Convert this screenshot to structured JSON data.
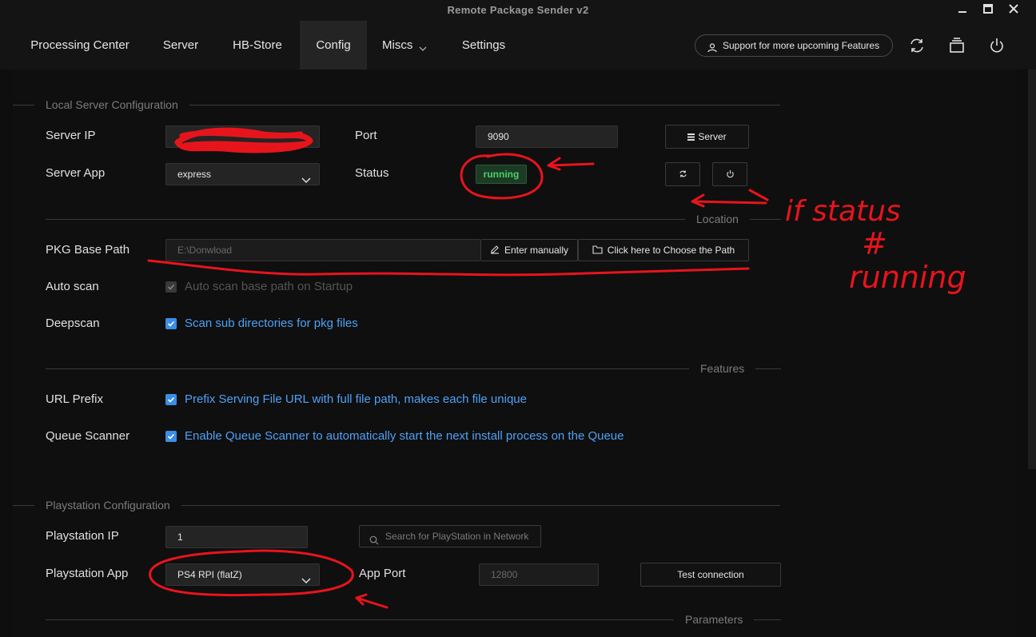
{
  "window": {
    "title": "Remote Package Sender v2"
  },
  "nav": {
    "tabs": [
      "Processing Center",
      "Server",
      "HB-Store",
      "Config",
      "Miscs",
      "Settings"
    ],
    "active": "Config",
    "support_label": "Support for more upcoming Features"
  },
  "local_server": {
    "section_title": "Local Server Configuration",
    "server_ip_label": "Server IP",
    "server_ip_value": "",
    "port_label": "Port",
    "port_value": "9090",
    "server_button": "Server",
    "server_app_label": "Server App",
    "server_app_value": "express",
    "status_label": "Status",
    "status_value": "running"
  },
  "location": {
    "section_title": "Location",
    "pkg_base_path_label": "PKG Base Path",
    "pkg_base_path_placeholder": "E:\\Donwload",
    "enter_manually_label": "Enter manually",
    "choose_path_label": "Click here to Choose the Path",
    "auto_scan_label": "Auto scan",
    "auto_scan_text": "Auto scan base path on Startup",
    "deepscan_label": "Deepscan",
    "deepscan_text": "Scan sub directories for pkg files"
  },
  "features": {
    "section_title": "Features",
    "url_prefix_label": "URL Prefix",
    "url_prefix_text": "Prefix Serving File URL with full file path, makes each file unique",
    "queue_scanner_label": "Queue Scanner",
    "queue_scanner_text": "Enable Queue Scanner to automatically start the next install process on the Queue"
  },
  "playstation": {
    "section_title": "Playstation Configuration",
    "ip_label": "Playstation IP",
    "ip_value": "1",
    "search_placeholder": "Search for PlayStation in Network",
    "app_label": "Playstation App",
    "app_value": "PS4 RPI (flatZ)",
    "app_port_label": "App Port",
    "app_port_value": "12800",
    "test_button": "Test connection"
  },
  "parameters": {
    "section_title": "Parameters"
  },
  "annotation": {
    "line1": "if status",
    "line2": "#",
    "line3": "running",
    "ink_color": "#e8141c"
  },
  "colors": {
    "accent": "#3b8de8",
    "status_green": "#4cd06a",
    "background": "#0f0f0f"
  }
}
